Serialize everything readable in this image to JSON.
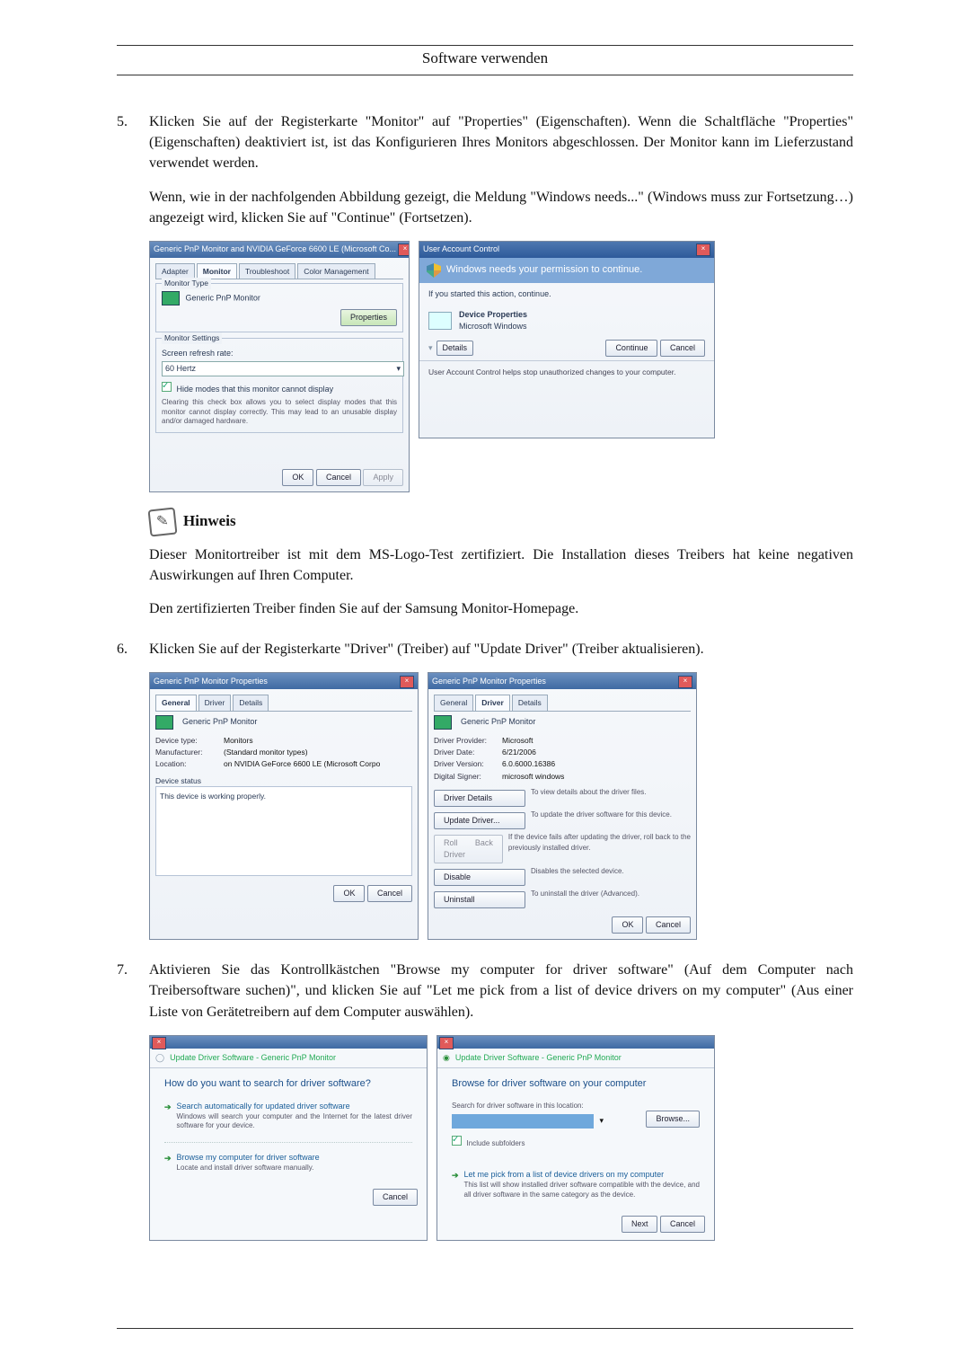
{
  "header": {
    "title": "Software verwenden"
  },
  "step5": {
    "para1": "Klicken Sie auf der Registerkarte \"Monitor\" auf \"Properties\" (Eigenschaften). Wenn die Schaltfläche \"Properties\" (Eigenschaften) deaktiviert ist, ist das Konfigurieren Ihres Monitors abgeschlossen. Der Monitor kann im Lieferzustand verwendet werden.",
    "para2": "Wenn, wie in der nachfolgenden Abbildung gezeigt, die Meldung \"Windows needs...\" (Windows muss zur Fortsetzung…) angezeigt wird, klicken Sie auf \"Continue\" (Fortsetzen)."
  },
  "monitorDialog": {
    "title": "Generic PnP Monitor and NVIDIA GeForce 6600 LE (Microsoft Co...",
    "tabs": {
      "adapter": "Adapter",
      "monitor": "Monitor",
      "troubleshoot": "Troubleshoot",
      "color": "Color Management"
    },
    "sectionType": "Monitor Type",
    "monitorName": "Generic PnP Monitor",
    "propertiesBtn": "Properties",
    "sectionSettings": "Monitor Settings",
    "refreshLabel": "Screen refresh rate:",
    "refreshValue": "60 Hertz",
    "hideModesLabel": "Hide modes that this monitor cannot display",
    "hideModesNote": "Clearing this check box allows you to select display modes that this monitor cannot display correctly. This may lead to an unusable display and/or damaged hardware.",
    "ok": "OK",
    "cancel": "Cancel",
    "apply": "Apply"
  },
  "uac": {
    "title": "User Account Control",
    "bigmsg": "Windows needs your permission to continue.",
    "sub": "If you started this action, continue.",
    "progName": "Device Properties",
    "progPub": "Microsoft Windows",
    "details": "Details",
    "continue": "Continue",
    "cancel": "Cancel",
    "foot": "User Account Control helps stop unauthorized changes to your computer."
  },
  "note": {
    "label": "Hinweis",
    "para1": "Dieser Monitortreiber ist mit dem MS-Logo-Test zertifiziert. Die Installation dieses Treibers hat keine negativen Auswirkungen auf Ihren Computer.",
    "para2": "Den zertifizierten Treiber finden Sie auf der Samsung Monitor-Homepage."
  },
  "step6": {
    "para": "Klicken Sie auf der Registerkarte \"Driver\" (Treiber) auf \"Update Driver\" (Treiber aktualisieren)."
  },
  "propGeneral": {
    "title": "Generic PnP Monitor Properties",
    "tabs": {
      "general": "General",
      "driver": "Driver",
      "details": "Details"
    },
    "name": "Generic PnP Monitor",
    "kv": {
      "devicetype_k": "Device type:",
      "devicetype_v": "Monitors",
      "manuf_k": "Manufacturer:",
      "manuf_v": "(Standard monitor types)",
      "loc_k": "Location:",
      "loc_v": "on NVIDIA GeForce 6600 LE (Microsoft Corpo"
    },
    "statusLabel": "Device status",
    "statusText": "This device is working properly.",
    "ok": "OK",
    "cancel": "Cancel"
  },
  "propDriver": {
    "title": "Generic PnP Monitor Properties",
    "tabs": {
      "general": "General",
      "driver": "Driver",
      "details": "Details"
    },
    "name": "Generic PnP Monitor",
    "kv": {
      "prov_k": "Driver Provider:",
      "prov_v": "Microsoft",
      "date_k": "Driver Date:",
      "date_v": "6/21/2006",
      "ver_k": "Driver Version:",
      "ver_v": "6.0.6000.16386",
      "sign_k": "Digital Signer:",
      "sign_v": "microsoft windows"
    },
    "btns": {
      "details": "Driver Details",
      "details_d": "To view details about the driver files.",
      "update": "Update Driver...",
      "update_d": "To update the driver software for this device.",
      "rollback": "Roll Back Driver",
      "rollback_d": "If the device fails after updating the driver, roll back to the previously installed driver.",
      "disable": "Disable",
      "disable_d": "Disables the selected device.",
      "uninstall": "Uninstall",
      "uninstall_d": "To uninstall the driver (Advanced)."
    },
    "ok": "OK",
    "cancel": "Cancel"
  },
  "step7": {
    "para": "Aktivieren Sie das Kontrollkästchen \"Browse my computer for driver software\" (Auf dem Computer nach Treibersoftware suchen)\", und klicken Sie auf \"Let me pick from a list of device drivers on my computer\" (Aus einer Liste von Gerätetreibern auf dem Computer auswählen)."
  },
  "wizard1": {
    "breadcrumb": "Update Driver Software - Generic PnP Monitor",
    "head": "How do you want to search for driver software?",
    "opt1_label": "Search automatically for updated driver software",
    "opt1_desc": "Windows will search your computer and the Internet for the latest driver software for your device.",
    "opt2_label": "Browse my computer for driver software",
    "opt2_desc": "Locate and install driver software manually.",
    "cancel": "Cancel"
  },
  "wizard2": {
    "breadcrumb": "Update Driver Software - Generic PnP Monitor",
    "head": "Browse for driver software on your computer",
    "searchLabel": "Search for driver software in this location:",
    "browse": "Browse...",
    "include": "Include subfolders",
    "opt_label": "Let me pick from a list of device drivers on my computer",
    "opt_desc": "This list will show installed driver software compatible with the device, and all driver software in the same category as the device.",
    "next": "Next",
    "cancel": "Cancel"
  }
}
